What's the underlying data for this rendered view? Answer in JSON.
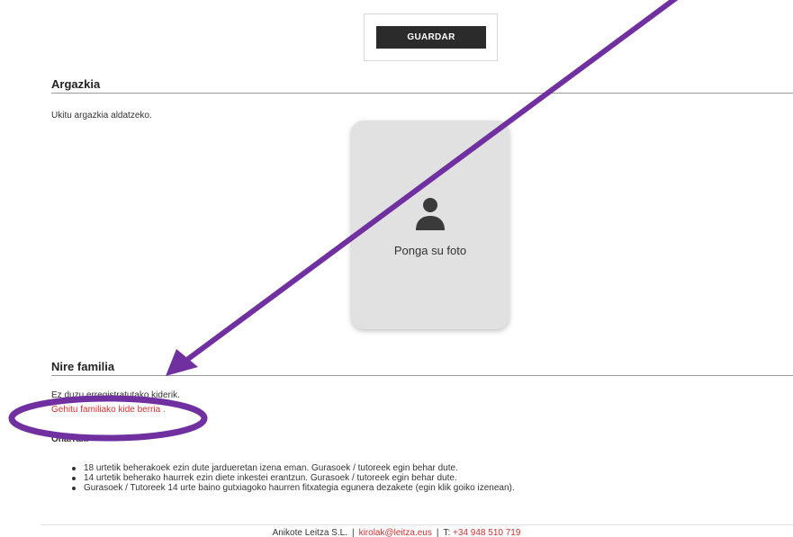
{
  "toolbar": {
    "save_label": "GUARDAR"
  },
  "photo_section": {
    "title": "Argazkia",
    "hint": "Ukitu argazkia aldatzeko.",
    "placeholder_label": "Ponga su foto",
    "icon": "user-icon"
  },
  "family_section": {
    "title": "Nire familia",
    "no_members_text": "Ez duzu erregistratutako kiderik.",
    "add_member_link": "Gehitu familiako kide berria .",
    "notes_label": "Oharrak:",
    "notes": [
      "18 urtetik beherakoek ezin dute jardueretan izena eman. Gurasoek / tutoreek egin behar dute.",
      "14 urtetik beherako haurrek ezin diete inkestei erantzun. Gurasoek / tutoreek egin behar dute.",
      "Gurasoek / Tutoreek 14 urte baino gutxiagoko haurren fitxategia egunera dezakete (egin klik goiko izenean)."
    ]
  },
  "footer": {
    "company": "Anikote Leitza S.L.",
    "separator": "|",
    "email": "kirolak@leitza.eus",
    "phone_prefix": "T:",
    "phone": "+34 948 510 719"
  },
  "annotation": {
    "color": "#7030a0"
  },
  "colors": {
    "link": "#d03030",
    "button_bg": "#2b2b2b",
    "card_bg": "#e1e1e1"
  }
}
